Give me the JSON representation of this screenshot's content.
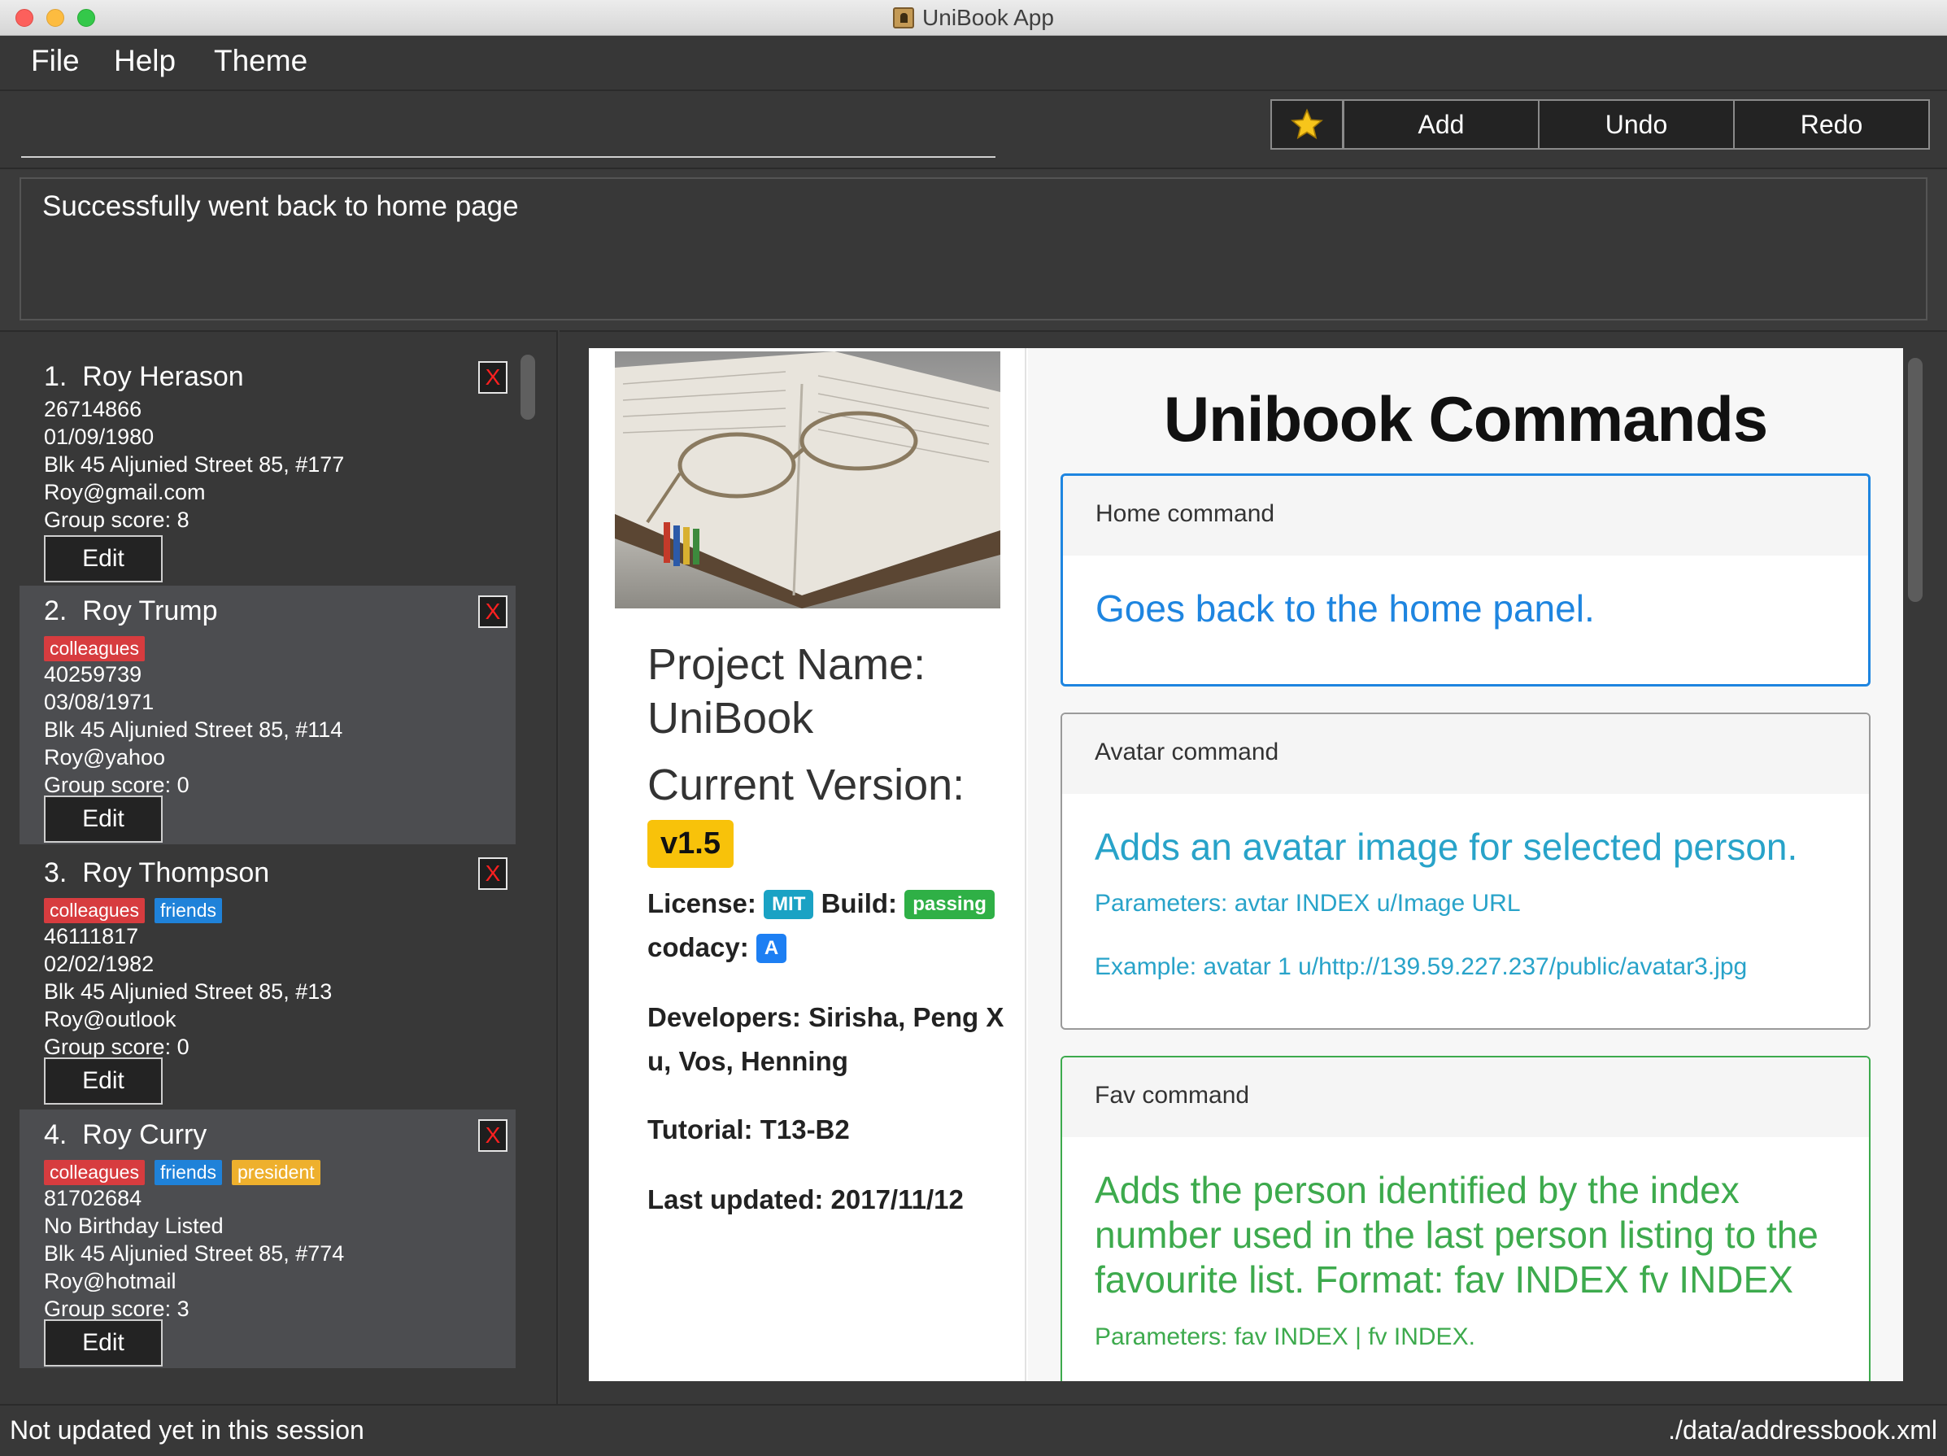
{
  "window": {
    "title": "UniBook App"
  },
  "menu": {
    "file": "File",
    "help": "Help",
    "theme": "Theme"
  },
  "toolbar": {
    "command_value": "",
    "add_label": "Add",
    "undo_label": "Undo",
    "redo_label": "Redo",
    "star_icon": "star-icon"
  },
  "result": {
    "text": "Successfully went back to home page"
  },
  "persons": [
    {
      "index": "1.",
      "name": "Roy Herason",
      "tags": [],
      "phone": "26714866",
      "birthday": "01/09/1980",
      "address": "Blk 45 Aljunied Street 85, #177",
      "email": "Roy@gmail.com",
      "score": "Group score: 8",
      "edit": "Edit",
      "delete": "X"
    },
    {
      "index": "2.",
      "name": "Roy Trump",
      "tags": [
        "colleagues"
      ],
      "phone": "40259739",
      "birthday": "03/08/1971",
      "address": "Blk 45 Aljunied Street 85, #114",
      "email": "Roy@yahoo",
      "score": "Group score: 0",
      "edit": "Edit",
      "delete": "X"
    },
    {
      "index": "3.",
      "name": "Roy Thompson",
      "tags": [
        "colleagues",
        "friends"
      ],
      "phone": "46111817",
      "birthday": "02/02/1982",
      "address": "Blk 45 Aljunied Street 85, #13",
      "email": "Roy@outlook",
      "score": "Group score: 0",
      "edit": "Edit",
      "delete": "X"
    },
    {
      "index": "4.",
      "name": "Roy Curry",
      "tags": [
        "colleagues",
        "friends",
        "president"
      ],
      "phone": "81702684",
      "birthday": "No Birthday Listed",
      "address": "Blk 45 Aljunied Street 85, #774",
      "email": "Roy@hotmail",
      "score": "Group score: 3",
      "edit": "Edit",
      "delete": "X"
    }
  ],
  "tag_colors": {
    "colleagues": "#d73c3f",
    "friends": "#1f82d9",
    "president": "#eeb02d"
  },
  "project": {
    "name_label": "Project Name:",
    "name": "UniBook",
    "version_label": "Current Version:",
    "version": "v1.5",
    "license_label": "License:",
    "license": "MIT",
    "build_label": "Build:",
    "build": "passing",
    "codacy_label": "codacy:",
    "codacy": "A",
    "developers_line1": "Developers: Sirisha, Peng X",
    "developers_line2": "u, Vos, Henning",
    "tutorial": "Tutorial: T13-B2",
    "updated": "Last updated: 2017/11/12"
  },
  "commands": {
    "title": "Unibook Commands",
    "home": {
      "head": "Home command",
      "desc": "Goes back to the home panel."
    },
    "avatar": {
      "head": "Avatar command",
      "desc": "Adds an avatar image for selected person.",
      "params": "Parameters: avtar INDEX u/Image URL",
      "example": "Example: avatar 1 u/http://139.59.227.237/public/avatar3.jpg"
    },
    "fav": {
      "head": "Fav command",
      "desc_line1": "Adds the person identified by the index",
      "desc_line2": "number used in the last person listing to the",
      "desc_line3": "favourite list. Format: fav INDEX fv INDEX",
      "params": "Parameters: fav INDEX | fv INDEX."
    }
  },
  "colors": {
    "blue_accent": "#1e85e0",
    "green_accent": "#3daa4d",
    "avatar_text": "#28a3c9"
  },
  "status": {
    "left": "Not updated yet in this session",
    "right": "./data/addressbook.xml"
  }
}
